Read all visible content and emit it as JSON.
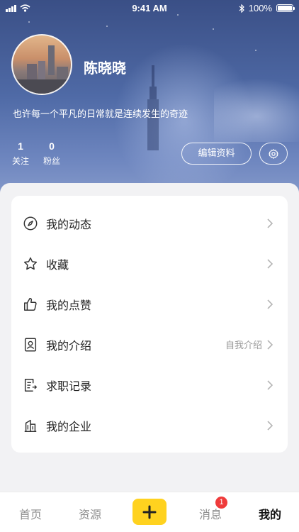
{
  "status_bar": {
    "time": "9:41 AM",
    "battery": "100%"
  },
  "profile": {
    "name": "陈晓晓",
    "bio": "也许每一个平凡的日常就是连续发生的奇迹",
    "stats": {
      "following_count": "1",
      "following_label": "关注",
      "fans_count": "0",
      "fans_label": "粉丝"
    },
    "edit_button": "编辑资料",
    "settings_icon": "gear-icon"
  },
  "menu": {
    "items": [
      {
        "label": "我的动态",
        "icon": "compass-icon",
        "hint": ""
      },
      {
        "label": "收藏",
        "icon": "star-icon",
        "hint": ""
      },
      {
        "label": "我的点赞",
        "icon": "thumbs-up-icon",
        "hint": ""
      },
      {
        "label": "我的介绍",
        "icon": "id-card-icon",
        "hint": "自我介绍"
      },
      {
        "label": "求职记录",
        "icon": "document-icon",
        "hint": ""
      },
      {
        "label": "我的企业",
        "icon": "building-icon",
        "hint": ""
      }
    ]
  },
  "tabbar": {
    "home": "首页",
    "resources": "资源",
    "messages": "消息",
    "messages_badge": "1",
    "me": "我的",
    "add_icon": "plus-icon",
    "add_color": "#ffd21f"
  },
  "colors": {
    "hero_top": "#3a4f86",
    "hero_bottom": "#8fa2cf",
    "badge": "#ef3b3b"
  }
}
